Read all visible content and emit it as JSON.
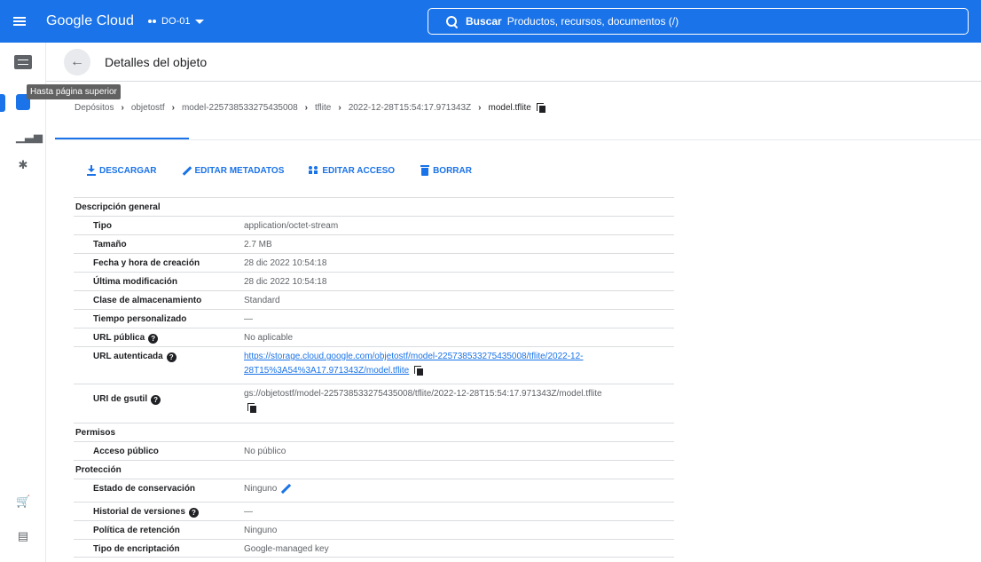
{
  "header": {
    "brand": "Google Cloud",
    "project": "DO-01",
    "search_label": "Buscar",
    "search_placeholder": "Productos, recursos, documentos (/)"
  },
  "rail": {
    "tooltip": "Hasta página superior"
  },
  "page": {
    "title": "Detalles del objeto"
  },
  "breadcrumb": [
    "Depósitos",
    "objetostf",
    "model-225738533275435008",
    "tflite",
    "2022-12-28T15:54:17.971343Z",
    "model.tflite"
  ],
  "actions": {
    "download": "DESCARGAR",
    "edit_metadata": "EDITAR METADATOS",
    "edit_access": "EDITAR ACCESO",
    "delete": "BORRAR"
  },
  "sections": {
    "overview": {
      "title": "Descripción general",
      "rows": [
        {
          "key": "Tipo",
          "value": "application/octet-stream"
        },
        {
          "key": "Tamaño",
          "value": "2.7 MB"
        },
        {
          "key": "Fecha y hora de creación",
          "value": "28 dic 2022 10:54:18"
        },
        {
          "key": "Última modificación",
          "value": "28 dic 2022 10:54:18"
        },
        {
          "key": "Clase de almacenamiento",
          "value": "Standard"
        },
        {
          "key": "Tiempo personalizado",
          "value": "—"
        },
        {
          "key": "URL pública",
          "value": "No aplicable"
        },
        {
          "key": "URL autenticada",
          "value": "https://storage.cloud.google.com/objetostf/model-225738533275435008/tflite/2022-12-28T15%3A54%3A17.971343Z/model.tflite",
          "line1": "https://storage.cloud.google.com/objetostf/model-225738533275435008/tflite/2022-12-",
          "line2": "28T15%3A54%3A17.971343Z/model.tflite"
        },
        {
          "key": "URI de gsutil",
          "value": "gs://objetostf/model-225738533275435008/tflite/2022-12-28T15:54:17.971343Z/model.tflite"
        }
      ]
    },
    "permissions": {
      "title": "Permisos",
      "rows": [
        {
          "key": "Acceso público",
          "value": "No público"
        }
      ]
    },
    "protection": {
      "title": "Protección",
      "rows": [
        {
          "key": "Estado de conservación",
          "value": "Ninguno"
        },
        {
          "key": "Historial de versiones",
          "value": "—"
        },
        {
          "key": "Política de retención",
          "value": "Ninguno"
        },
        {
          "key": "Tipo de encriptación",
          "value": "Google-managed key"
        }
      ]
    }
  },
  "help_glyph": "?"
}
